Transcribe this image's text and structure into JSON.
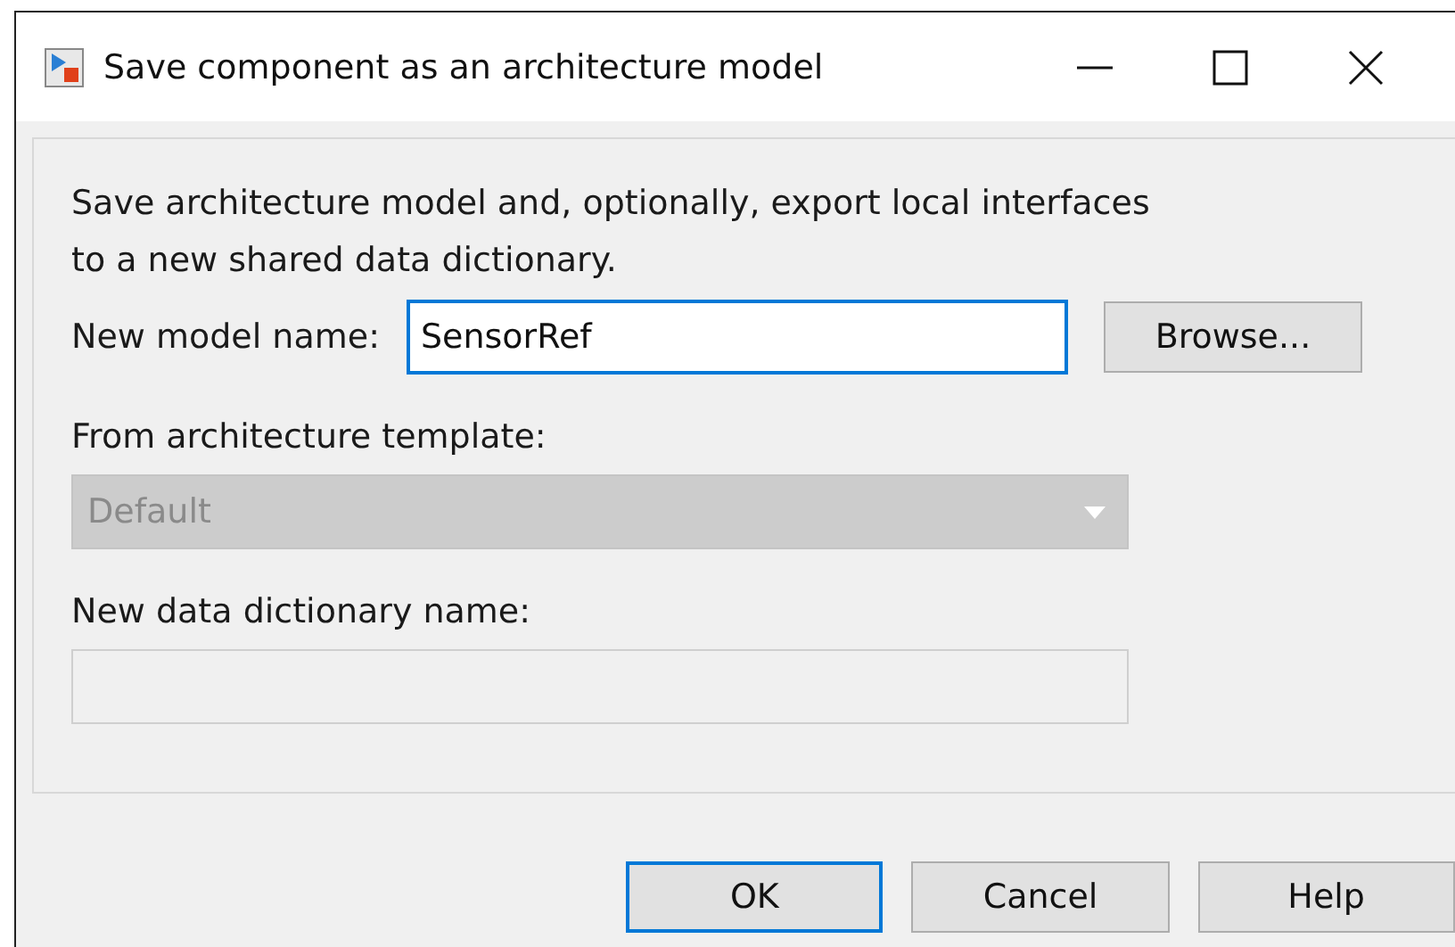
{
  "window": {
    "title": "Save component as an architecture model"
  },
  "description": "Save architecture model and, optionally, export local interfaces to a new shared data dictionary.",
  "model_name": {
    "label": "New model name:",
    "value": "SensorRef",
    "focused": true
  },
  "browse_button": "Browse...",
  "template": {
    "label": "From architecture template:",
    "value": "Default",
    "disabled": true
  },
  "dictionary": {
    "label": "New data dictionary name:",
    "disabled": true
  },
  "buttons": [
    {
      "label": "OK",
      "default": true
    },
    {
      "label": "Cancel",
      "default": false
    },
    {
      "label": "Help",
      "default": false
    }
  ]
}
